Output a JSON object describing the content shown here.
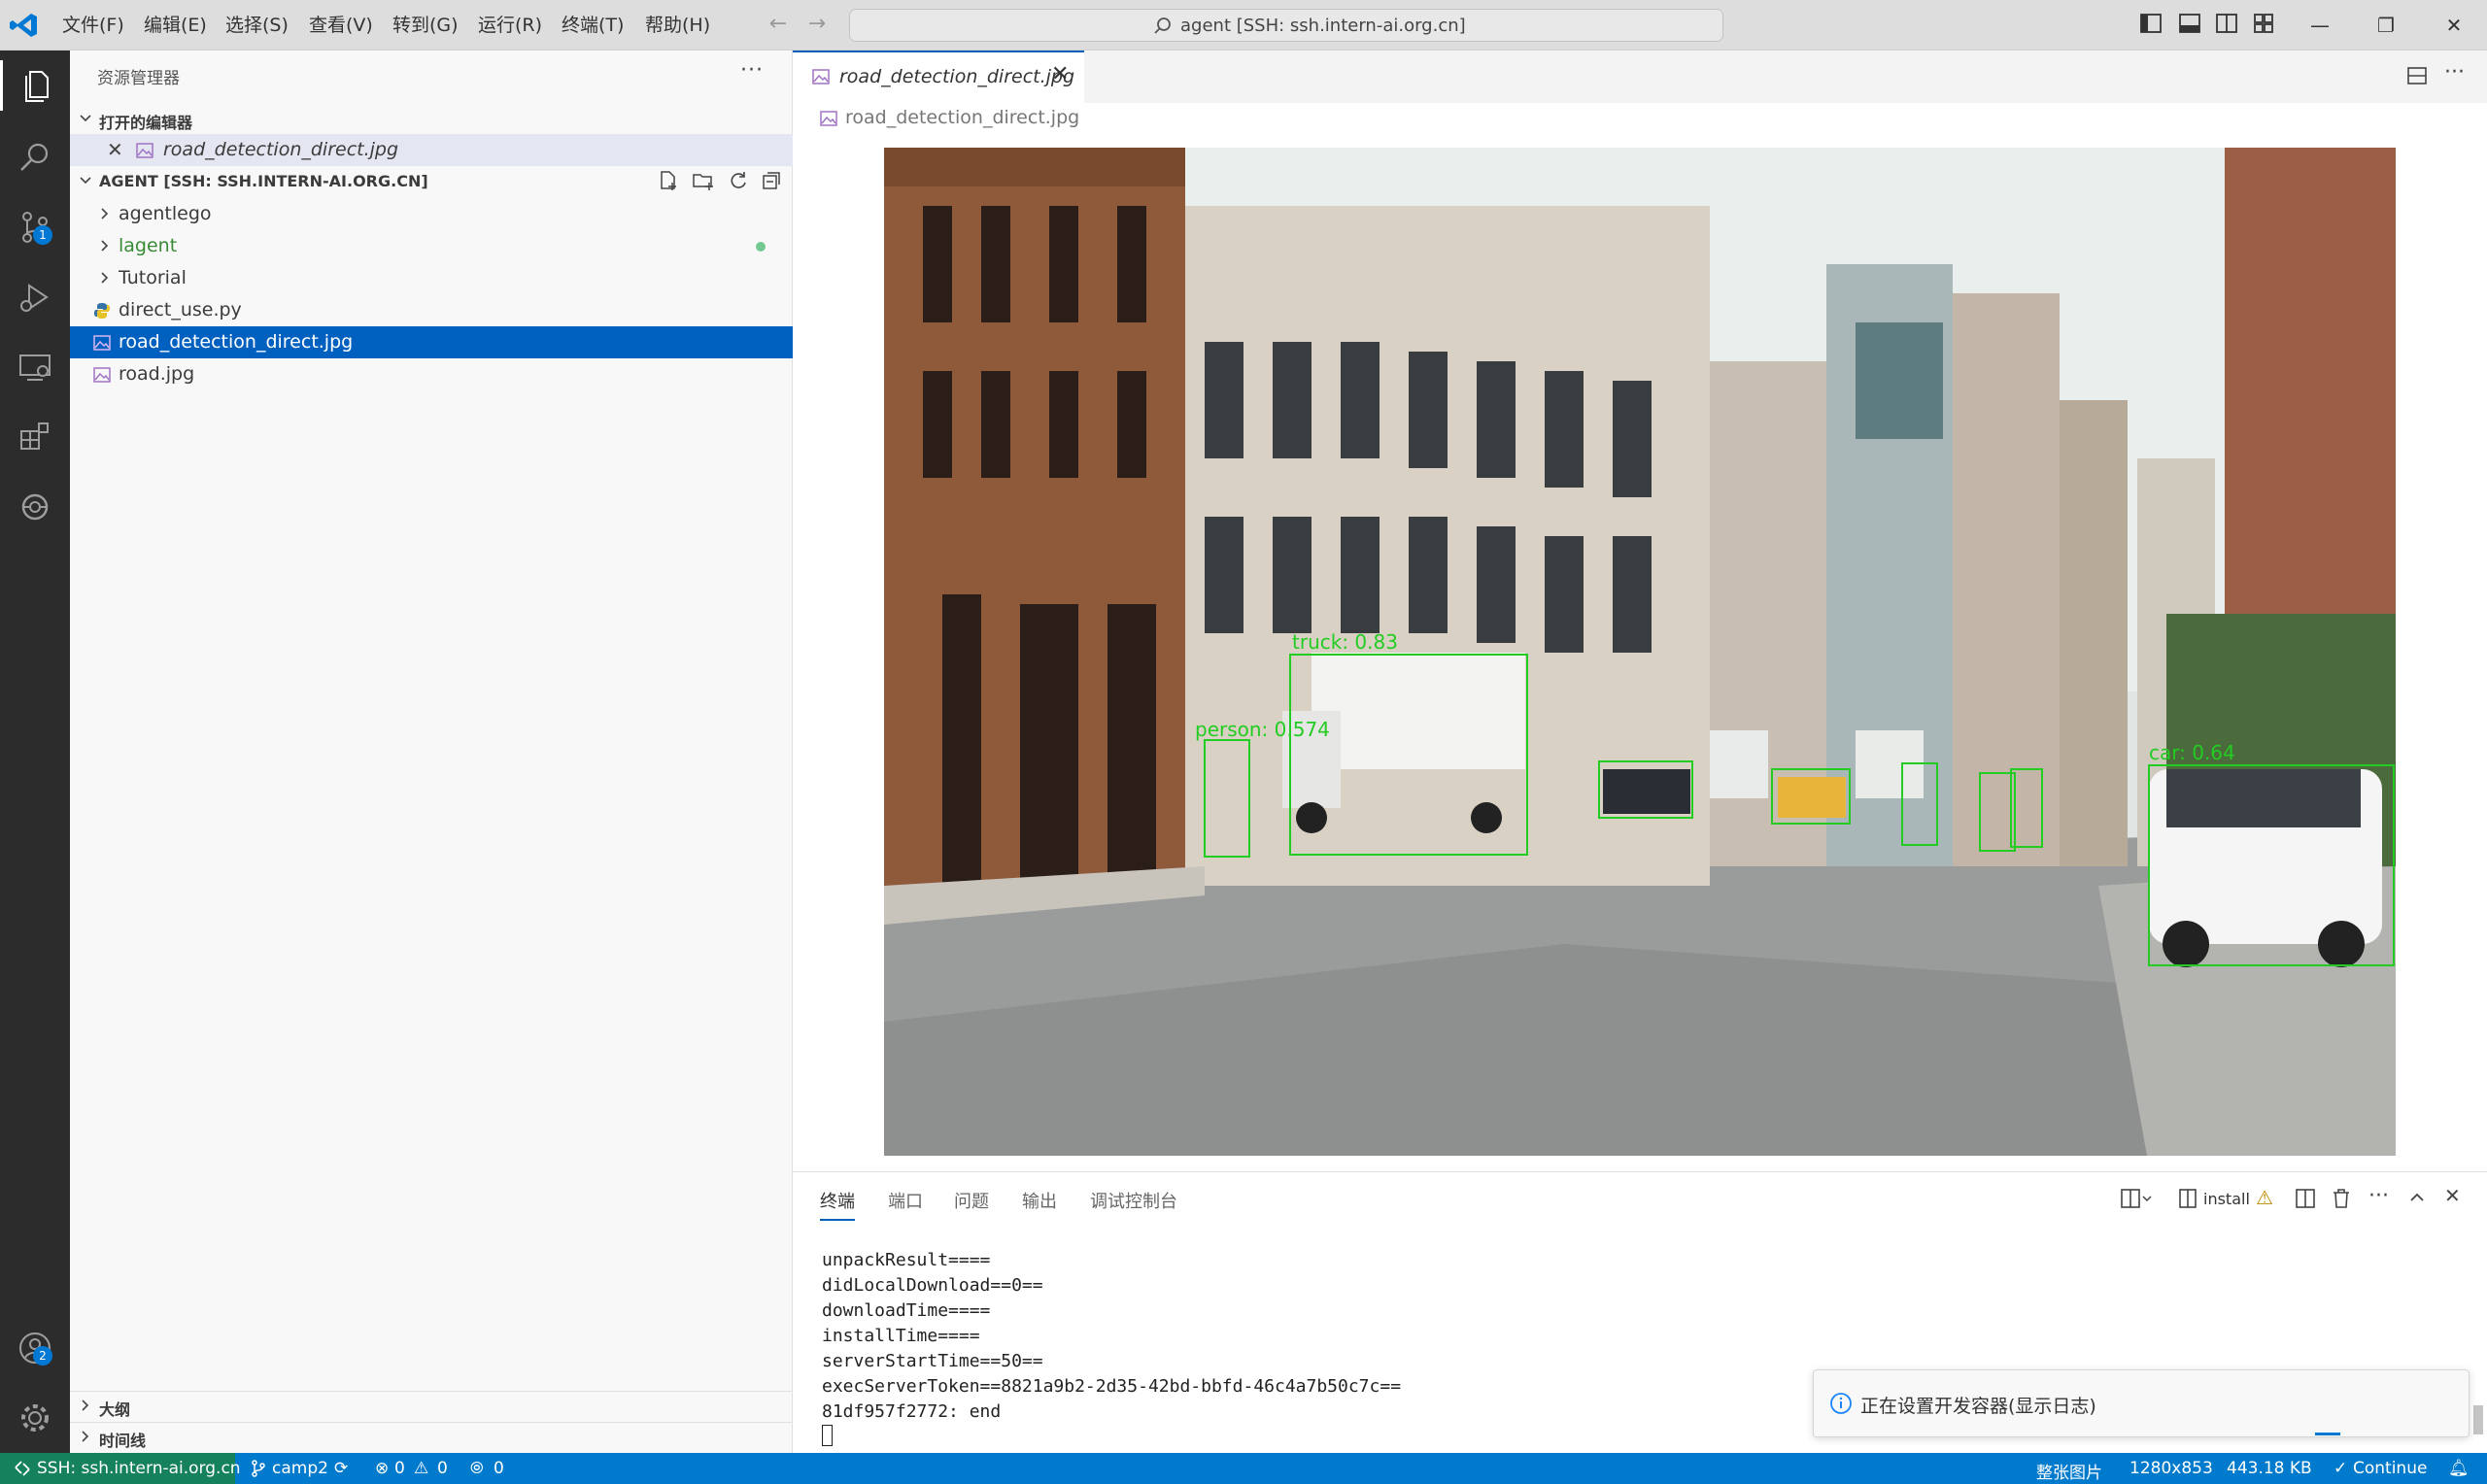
{
  "titlebar": {
    "menus": [
      "文件(F)",
      "编辑(E)",
      "选择(S)",
      "查看(V)",
      "转到(G)",
      "运行(R)",
      "终端(T)",
      "帮助(H)"
    ],
    "search_text": "agent [SSH: ssh.intern-ai.org.cn]"
  },
  "activity_bar": {
    "items": [
      "explorer-icon",
      "search-icon",
      "source-control-icon",
      "run-debug-icon",
      "remote-explorer-icon",
      "extensions-icon",
      "copilot-icon",
      "accounts-icon",
      "manage-gear-icon"
    ],
    "source_control_badge": "1",
    "accounts_badge": "2"
  },
  "sidebar": {
    "title": "资源管理器",
    "open_editors_label": "打开的编辑器",
    "open_editor_file": "road_detection_direct.jpg",
    "workspace_label": "AGENT [SSH: SSH.INTERN-AI.ORG.CN]",
    "tree": [
      {
        "name": "agentlego",
        "type": "folder"
      },
      {
        "name": "lagent",
        "type": "folder"
      },
      {
        "name": "Tutorial",
        "type": "folder"
      },
      {
        "name": "direct_use.py",
        "type": "python"
      },
      {
        "name": "road_detection_direct.jpg",
        "type": "image"
      },
      {
        "name": "road.jpg",
        "type": "image"
      }
    ],
    "outline_label": "大纲",
    "timeline_label": "时间线",
    "lagent_dot_color": "#73c991"
  },
  "editor": {
    "tab_label": "road_detection_direct.jpg",
    "breadcrumb": "road_detection_direct.jpg"
  },
  "panel": {
    "tabs": [
      "终端",
      "端口",
      "问题",
      "输出",
      "调试控制台"
    ],
    "terminal_name": "install",
    "terminal_lines": [
      "unpackResult====",
      "didLocalDownload==0==",
      "downloadTime====",
      "installTime====",
      "serverStartTime==50==",
      "execServerToken==8821a9b2-2d35-42bd-bbfd-46c4a7b50c7c==",
      "81df957f2772: end"
    ]
  },
  "notification": {
    "text": "正在设置开发容器(显示日志)"
  },
  "statusbar": {
    "remote": "SSH: ssh.intern-ai.org.cn",
    "branch": "camp2",
    "errors": "0",
    "warnings": "0",
    "ports": "0",
    "zoom": "整张图片",
    "dimensions": "1280x853",
    "filesize": "443.18 KB",
    "continue": "Continue"
  },
  "colors": {
    "accent": "#007acc",
    "remote_bg": "#16825d",
    "selection": "#0060c0",
    "folder_green": "#388a34",
    "detection_box": "#22cc22"
  }
}
